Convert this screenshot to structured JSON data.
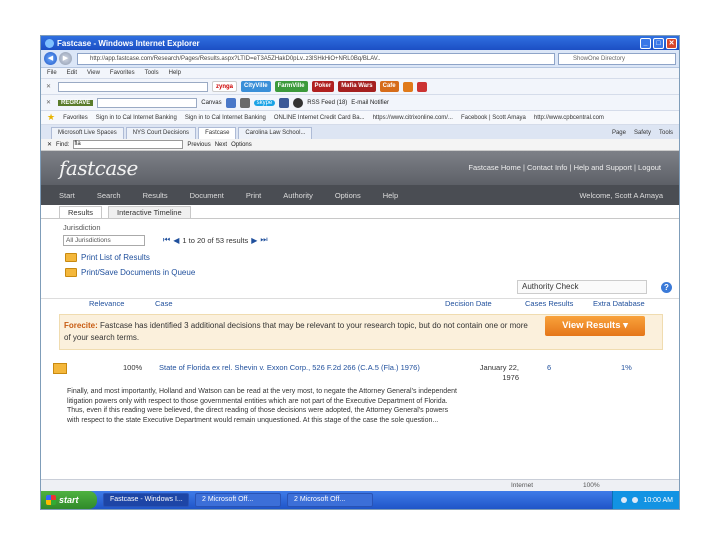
{
  "window": {
    "title": "Fastcase - Windows Internet Explorer",
    "url": "http://app.fastcase.com/Research/Pages/Results.aspx?LTID=eT3A5ZHakD0pLv..z3lSHkHiO+NRL0Bq/BLAV..",
    "search_placeholder": "ShowOne Directory"
  },
  "menubar": [
    "File",
    "Edit",
    "View",
    "Favorites",
    "Tools",
    "Help"
  ],
  "toolbar1": {
    "zynga": "zynga",
    "cityville": "CityVille",
    "farmville": "FarmVille",
    "poker": "Poker",
    "mafia": "Mafia Wars",
    "cafe": "Cafe"
  },
  "toolbar2": {
    "reg": "REGRAVE",
    "canvas": "Canvas",
    "skype": "skype",
    "rss": "RSS Feed (18)",
    "email": "E-mail Notifier"
  },
  "favorites": {
    "label": "Favorites",
    "items": [
      "Sign in to Cal Internet Banking",
      "Sign in to Cal Internet Banking",
      "ONLINE Internet Credit Card Ba...",
      "https://www.citrixonline.com/...",
      "Facebook | Scott Amaya",
      "http://www.cpbcentral.com"
    ]
  },
  "tabs": [
    "Microsoft Live Spaces",
    "NYS Court Decisions",
    "Fastcase",
    "Carolina Law School..."
  ],
  "tab_tools": [
    "Page",
    "Safety",
    "Tools"
  ],
  "findbar": {
    "label": "Find:",
    "value": "fla",
    "prev": "Previous",
    "next": "Next",
    "options": "Options"
  },
  "fastcase": {
    "logo": "fastcase",
    "toplinks": "Fastcase Home | Contact Info | Help and Support | Logout",
    "nav": [
      "Start",
      "Search",
      "Results",
      "Document",
      "Print",
      "Authority",
      "Options",
      "Help"
    ],
    "welcome": "Welcome, Scott A Amaya",
    "subtabs": [
      "Results",
      "Interactive Timeline"
    ],
    "jurisdiction_label": "Jurisdiction",
    "jurisdiction_value": "All Jurisdictions",
    "pager": "1 to 20 of 53 results",
    "print_list": "Print List of Results",
    "print_save": "Print/Save Documents in Queue",
    "authority_check": "Authority Check",
    "columns": {
      "relevance": "Relevance",
      "case": "Case",
      "decision_date": "Decision Date",
      "cases": "Cases Results",
      "extra": "Extra Database"
    },
    "forecite_label": "Forecite:",
    "forecite_text": " Fastcase has identified 3 additional decisions that may be relevant to your research topic, but do not contain one or more of your search terms.",
    "view_results": "View Results",
    "result": {
      "relevance": "100%",
      "case": "State of Florida ex rel. Shevin v. Exxon Corp., 526 F.2d 266 (C.A.5 (Fla.) 1976)",
      "date": "January 22, 1976",
      "cases": "6",
      "extra": "1%",
      "snippet": "Finally, and most importantly, Holland and Watson can be read at the very most, to negate the Attorney General's independent litigation powers only with respect to those governmental entities which are not part of the Executive Department of Florida. Thus, even if this reading were believed, the direct reading of those decisions were adopted, the Attorney General's powers with respect to the state Executive Department would remain unquestioned. At this stage of the case the sole question..."
    }
  },
  "statusbar": {
    "zone": "Internet",
    "zoom": "100%"
  },
  "taskbar": {
    "start": "start",
    "tasks": [
      "Fastcase - Windows I...",
      "2 Microsoft Off...",
      "2 Microsoft Off..."
    ],
    "clock": "10:00 AM"
  }
}
